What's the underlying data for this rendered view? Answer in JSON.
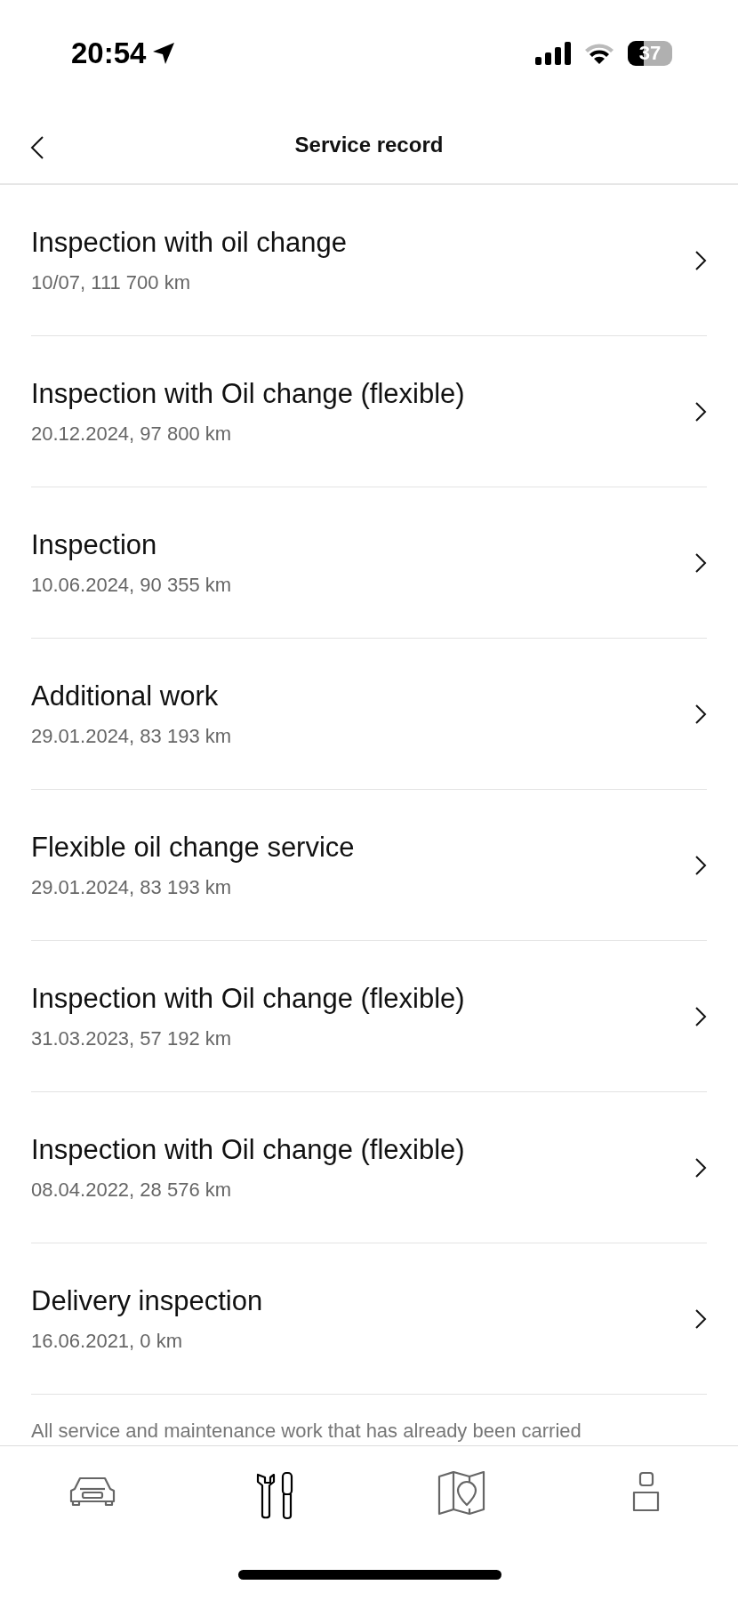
{
  "status_bar": {
    "time": "20:54",
    "battery": "37"
  },
  "header": {
    "title": "Service record"
  },
  "records": [
    {
      "title": "Inspection with oil change",
      "detail": "10/07, 111 700 km"
    },
    {
      "title": "Inspection with Oil change (flexible)",
      "detail": "20.12.2024, 97 800 km"
    },
    {
      "title": "Inspection",
      "detail": "10.06.2024, 90 355 km"
    },
    {
      "title": "Additional work",
      "detail": "29.01.2024, 83 193 km"
    },
    {
      "title": "Flexible oil change service",
      "detail": "29.01.2024, 83 193 km"
    },
    {
      "title": "Inspection with Oil change (flexible)",
      "detail": "31.03.2023, 57 192 km"
    },
    {
      "title": "Inspection with Oil change (flexible)",
      "detail": "08.04.2022, 28 576 km"
    },
    {
      "title": "Delivery inspection",
      "detail": "16.06.2021, 0 km"
    }
  ],
  "footer_note": "All service and maintenance work that has already been carried",
  "tab_bar": [
    {
      "kind": "car",
      "selected": false
    },
    {
      "kind": "tools",
      "selected": true
    },
    {
      "kind": "map",
      "selected": false
    },
    {
      "kind": "profile",
      "selected": false
    }
  ]
}
